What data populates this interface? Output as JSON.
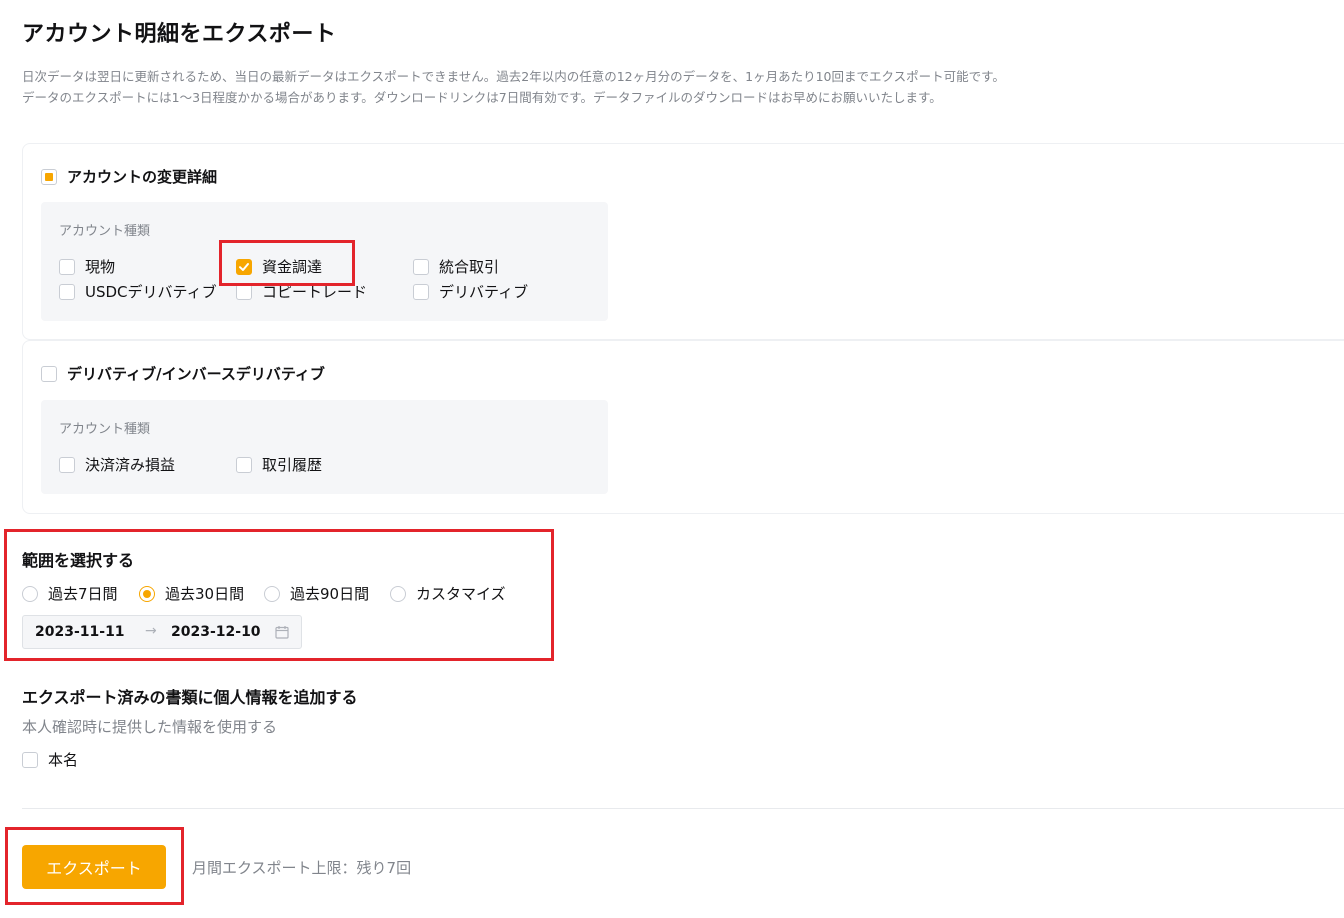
{
  "page": {
    "title": "アカウント明細をエクスポート",
    "desc_line1": "日次データは翌日に更新されるため、当日の最新データはエクスポートできません。過去2年以内の任意の12ヶ月分のデータを、1ヶ月あたり10回までエクスポート可能です。",
    "desc_line2": "データのエクスポートには1～3日程度かかる場合があります。ダウンロードリンクは7日間有効です。データファイルのダウンロードはお早めにお願いいたします。"
  },
  "group1": {
    "title": "アカウントの変更詳細",
    "state": "partial",
    "panel_label": "アカウント種類",
    "options": [
      {
        "label": "現物",
        "checked": false
      },
      {
        "label": "資金調達",
        "checked": true
      },
      {
        "label": "統合取引",
        "checked": false
      },
      {
        "label": "USDCデリバティブ",
        "checked": false
      },
      {
        "label": "コピートレード",
        "checked": false
      },
      {
        "label": "デリバティブ",
        "checked": false
      }
    ]
  },
  "group2": {
    "title": "デリバティブ/インバースデリバティブ",
    "panel_label": "アカウント種類",
    "options": [
      {
        "label": "決済済み損益",
        "checked": false
      },
      {
        "label": "取引履歴",
        "checked": false
      }
    ]
  },
  "range": {
    "title": "範囲を選択する",
    "options": [
      "過去7日間",
      "過去30日間",
      "過去90日間",
      "カスタマイズ"
    ],
    "selected": "過去30日間",
    "start_date": "2023-11-11",
    "end_date": "2023-12-10",
    "separator": "→"
  },
  "personal": {
    "title": "エクスポート済みの書類に個人情報を追加する",
    "subtitle": "本人確認時に提供した情報を使用する",
    "option": "本名"
  },
  "footer": {
    "export_label": "エクスポート",
    "limit_text": "月間エクスポート上限：残り7回"
  },
  "colors": {
    "accent": "#f7a600",
    "highlight": "#e3242b"
  }
}
